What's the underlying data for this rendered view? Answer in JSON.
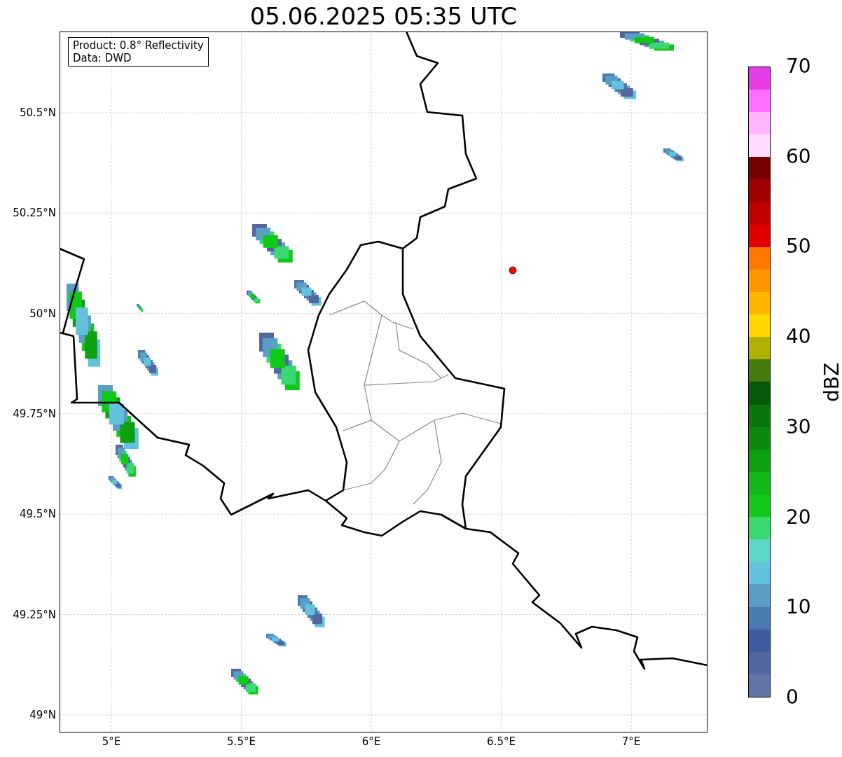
{
  "title": "05.06.2025 05:35 UTC",
  "info_box": [
    "Product: 0.8° Reflectivity",
    "Data: DWD"
  ],
  "latitude_labels": [
    "50.5°N",
    "50.25°N",
    "50°N",
    "49.75°N",
    "49.5°N",
    "49.25°N",
    "49°N"
  ],
  "longitude_labels": [
    "5°E",
    "5.5°E",
    "6°E",
    "6.5°E",
    "7°E"
  ],
  "colorbar": {
    "label": "dBZ",
    "ticks": [
      "70",
      "60",
      "50",
      "40",
      "30",
      "20",
      "10",
      "0"
    ],
    "bins": [
      {
        "color": "#6574a6"
      },
      {
        "color": "#5366a0"
      },
      {
        "color": "#405ca0"
      },
      {
        "color": "#4a7ab2"
      },
      {
        "color": "#5a9ec6"
      },
      {
        "color": "#62c2dc"
      },
      {
        "color": "#5ed8c6"
      },
      {
        "color": "#3ad870"
      },
      {
        "color": "#10c818"
      },
      {
        "color": "#10b818"
      },
      {
        "color": "#0ea010"
      },
      {
        "color": "#0c8a0e"
      },
      {
        "color": "#0a760c"
      },
      {
        "color": "#065a08"
      },
      {
        "color": "#467a0c"
      },
      {
        "color": "#b0b000"
      },
      {
        "color": "#ffd700"
      },
      {
        "color": "#ffb400"
      },
      {
        "color": "#ff9600"
      },
      {
        "color": "#ff7800"
      },
      {
        "color": "#e00000"
      },
      {
        "color": "#c00000"
      },
      {
        "color": "#a00000"
      },
      {
        "color": "#780000"
      },
      {
        "color": "#ffdcff"
      },
      {
        "color": "#ffb4ff"
      },
      {
        "color": "#ff6eff"
      },
      {
        "color": "#e63ce6"
      }
    ]
  }
}
